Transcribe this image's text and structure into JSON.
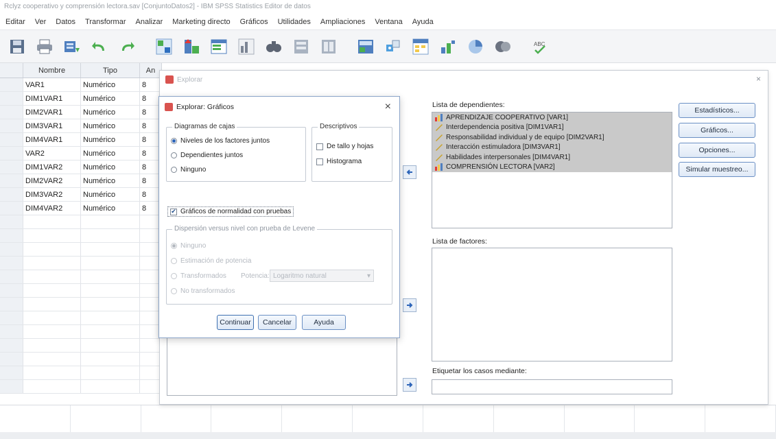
{
  "window": {
    "title": "Rclyz cooperativo y comprensión lectora.sav [ConjuntoDatos2] - IBM SPSS Statistics Editor de datos"
  },
  "menu": [
    "Editar",
    "Ver",
    "Datos",
    "Transformar",
    "Analizar",
    "Marketing directo",
    "Gráficos",
    "Utilidades",
    "Ampliaciones",
    "Ventana",
    "Ayuda"
  ],
  "toolbar": {
    "icons": [
      "save-icon",
      "print-icon",
      "dialog-recall-icon",
      "undo-icon",
      "redo-icon",
      "goto-case-icon",
      "goto-variable-icon",
      "variables-icon",
      "chart-icon",
      "find-icon",
      "split-file-icon",
      "select-cases-icon",
      "weight-cases-icon",
      "value-labels-icon",
      "use-sets-icon",
      "show-all-icon",
      "spelling-icon"
    ]
  },
  "grid": {
    "headers": [
      "Nombre",
      "Tipo",
      "An"
    ],
    "rows": [
      {
        "num": "",
        "name": "VAR1",
        "type": "Numérico",
        "width": "8"
      },
      {
        "num": "",
        "name": "DIM1VAR1",
        "type": "Numérico",
        "width": "8"
      },
      {
        "num": "",
        "name": "DIM2VAR1",
        "type": "Numérico",
        "width": "8"
      },
      {
        "num": "",
        "name": "DIM3VAR1",
        "type": "Numérico",
        "width": "8"
      },
      {
        "num": "",
        "name": "DIM4VAR1",
        "type": "Numérico",
        "width": "8"
      },
      {
        "num": "",
        "name": "VAR2",
        "type": "Numérico",
        "width": "8"
      },
      {
        "num": "",
        "name": "DIM1VAR2",
        "type": "Numérico",
        "width": "8"
      },
      {
        "num": "",
        "name": "DIM2VAR2",
        "type": "Numérico",
        "width": "8"
      },
      {
        "num": "",
        "name": "DIM3VAR2",
        "type": "Numérico",
        "width": "8"
      },
      {
        "num": "",
        "name": "DIM4VAR2",
        "type": "Numérico",
        "width": "8"
      }
    ]
  },
  "explorar": {
    "title": "Explorar",
    "close": "×",
    "dependents_label": "Lista de dependientes:",
    "dependents": [
      "APRENDIZAJE COOPERATIVO [VAR1]",
      "Interdependencia positiva [DIM1VAR1]",
      "Responsabilidad individual y de equipo [DIM2VAR1]",
      "Interacción estimuladora [DIM3VAR1]",
      "Habilidades interpersonales [DIM4VAR1]",
      "COMPRENSIÓN LECTORA [VAR2]"
    ],
    "factors_label": "Lista de factores:",
    "label_cases": "Etiquetar los casos mediante:",
    "buttons": {
      "estadisticos": "Estadísticos...",
      "graficos": "Gráficos...",
      "opciones": "Opciones...",
      "simular": "Simular muestreo..."
    }
  },
  "graficos": {
    "title": "Explorar: Gráficos",
    "close": "×",
    "boxplots": {
      "title": "Diagramas de cajas",
      "options": [
        "Niveles de los factores juntos",
        "Dependientes juntos",
        "Ninguno"
      ]
    },
    "descriptives": {
      "title": "Descriptivos",
      "options": [
        "De tallo y hojas",
        "Histograma"
      ]
    },
    "normality": "Gráficos de normalidad con pruebas",
    "spread": {
      "title": "Dispersión versus nivel con prueba de Levene",
      "options": [
        "Ninguno",
        "Estimación de potencia",
        "Transformados",
        "No transformados"
      ],
      "power_label": "Potencia:",
      "power_value": "Logaritmo natural"
    },
    "buttons": {
      "continuar": "Continuar",
      "cancelar": "Cancelar",
      "ayuda": "Ayuda"
    }
  }
}
